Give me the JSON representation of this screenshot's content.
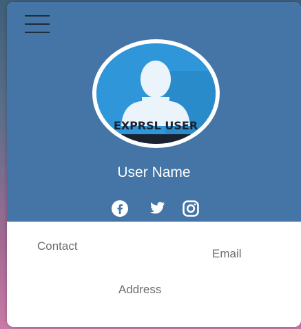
{
  "profile": {
    "avatar_text": "EXPRSL USER",
    "name": "User Name"
  },
  "socials": [
    {
      "icon": "facebook-icon"
    },
    {
      "icon": "twitter-icon"
    },
    {
      "icon": "instagram-icon"
    }
  ],
  "details": {
    "contact": "Contact",
    "email": "Email",
    "address": "Address"
  },
  "colors": {
    "header": "#4475a6",
    "card": "#ffffff",
    "text_muted": "#6d6d6d"
  }
}
